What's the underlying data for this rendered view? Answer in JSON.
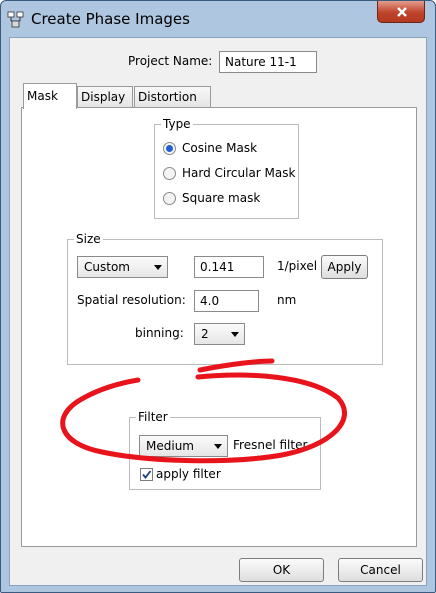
{
  "window": {
    "title": "Create Phase Images",
    "close_glyph": "x"
  },
  "project": {
    "label": "Project Name:",
    "value": "Nature 11-1"
  },
  "tabs": [
    {
      "label": "Mask"
    },
    {
      "label": "Display"
    },
    {
      "label": "Distortion"
    }
  ],
  "type_group": {
    "legend": "Type",
    "options": [
      {
        "label": "Cosine Mask",
        "selected": true
      },
      {
        "label": "Hard Circular Mask",
        "selected": false
      },
      {
        "label": "Square mask",
        "selected": false
      }
    ]
  },
  "size_group": {
    "legend": "Size",
    "mode": "Custom",
    "pixel_value": "0.141",
    "pixel_unit": "1/pixel",
    "apply_label": "Apply",
    "resolution_label": "Spatial resolution:",
    "resolution_value": "4.0",
    "resolution_unit": "nm",
    "binning_label": "binning:",
    "binning_value": "2"
  },
  "filter_group": {
    "legend": "Filter",
    "strength": "Medium",
    "filter_label": "Fresnel filter",
    "apply_filter_label": "apply filter",
    "apply_filter_checked": true
  },
  "footer": {
    "ok_label": "OK",
    "cancel_label": "Cancel"
  },
  "colors": {
    "annotation": "#e8131b",
    "radio_dot": "#1f5fd0",
    "titlebar": "#aec6e0",
    "close_button": "#c0432b"
  }
}
